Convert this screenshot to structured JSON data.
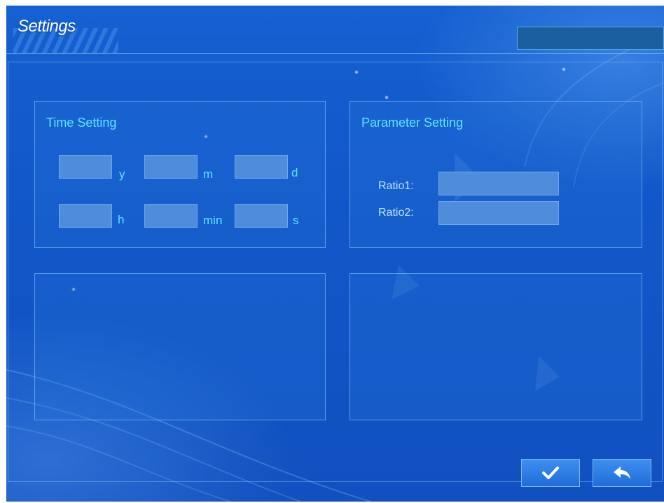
{
  "window": {
    "title": "Settings"
  },
  "time_setting": {
    "title": "Time Setting",
    "fields": [
      {
        "unit": "y",
        "value": ""
      },
      {
        "unit": "m",
        "value": ""
      },
      {
        "unit": "d",
        "value": ""
      },
      {
        "unit": "h",
        "value": ""
      },
      {
        "unit": "min",
        "value": ""
      },
      {
        "unit": "s",
        "value": ""
      }
    ]
  },
  "parameter_setting": {
    "title": "Parameter Setting",
    "ratios": [
      {
        "label": "Ratio1:",
        "value": ""
      },
      {
        "label": "Ratio2:",
        "value": ""
      }
    ]
  },
  "actions": {
    "confirm_icon": "checkmark-icon",
    "back_icon": "return-arrow-icon"
  },
  "colors": {
    "background": "#1257c9",
    "accent_text": "#5fe6ff",
    "field_fill": "#4f8ddc",
    "button_fill": "#2f7fe6"
  }
}
